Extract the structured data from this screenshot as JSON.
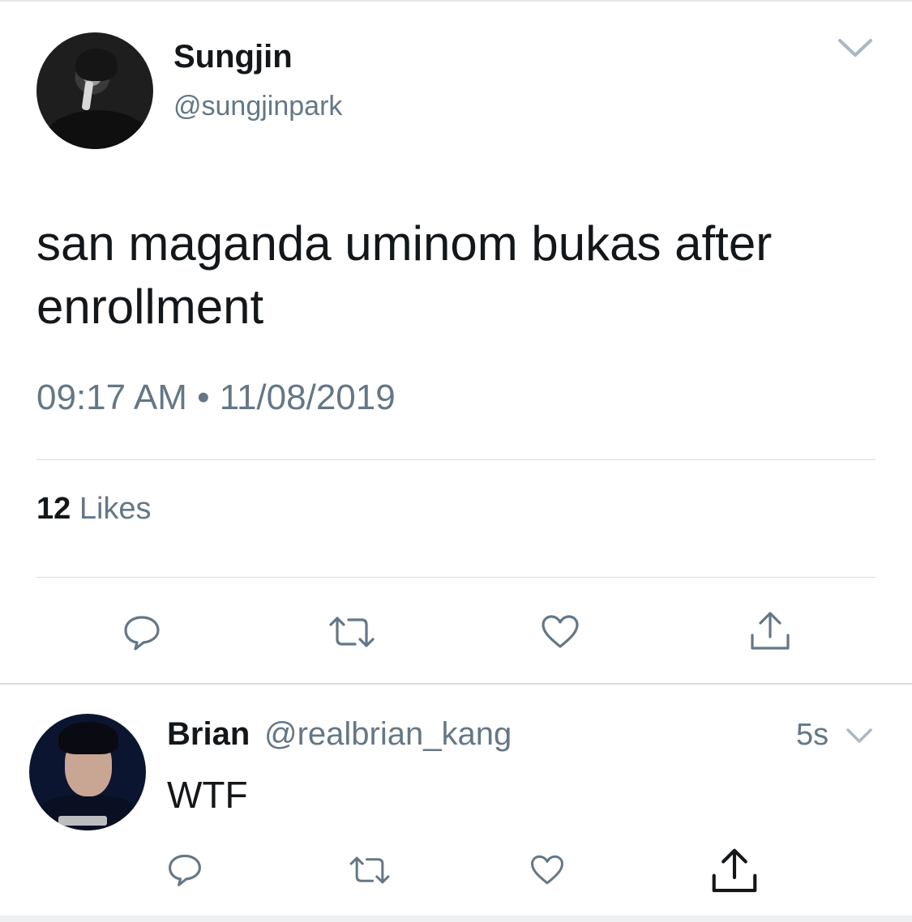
{
  "main_tweet": {
    "display_name": "Sungjin",
    "handle": "@sungjinpark",
    "text": "san maganda uminom bukas after enrollment",
    "timestamp": "09:17 AM • 11/08/2019",
    "likes_count": "12",
    "likes_label": "Likes"
  },
  "reply_tweet": {
    "display_name": "Brian",
    "handle": "@realbrian_kang",
    "time": "5s",
    "text": "WTF"
  },
  "actions": {
    "icons": [
      "reply-icon",
      "retweet-icon",
      "like-icon",
      "share-icon"
    ]
  },
  "colors": {
    "primary_text": "#14171a",
    "secondary_text": "#657786",
    "divider": "#d8dde1"
  }
}
